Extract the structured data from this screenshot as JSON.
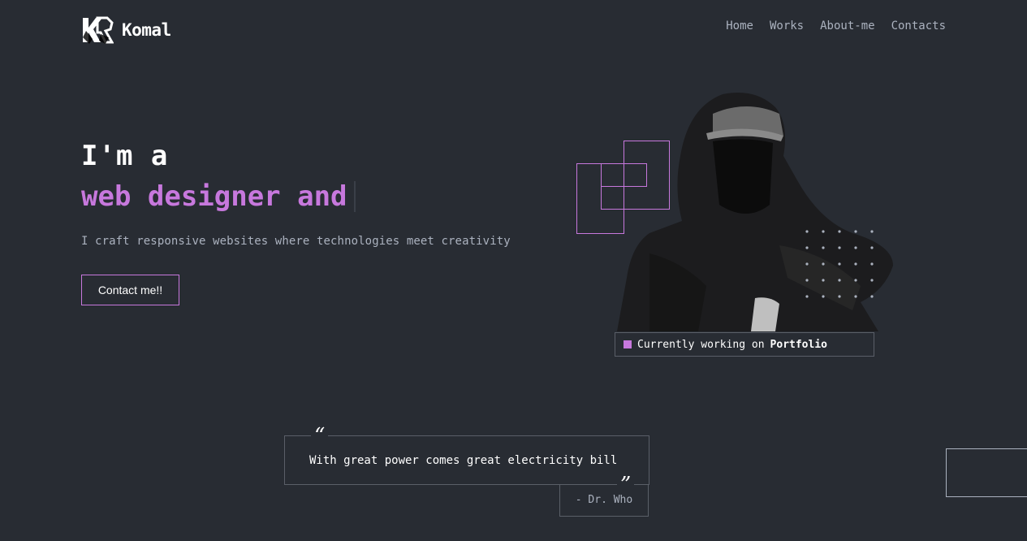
{
  "brand": {
    "name": "Komal",
    "icon": "kr-logo-icon"
  },
  "nav": {
    "items": [
      {
        "label": "Home"
      },
      {
        "label": "Works"
      },
      {
        "label": "About-me"
      },
      {
        "label": "Contacts"
      }
    ]
  },
  "hero": {
    "line1": "I'm a",
    "line2": "web designer and",
    "subtitle": "I craft responsive websites where technologies meet creativity",
    "cta_label": "Contact me!!"
  },
  "status": {
    "text": "Currently working on",
    "project": "Portfolio"
  },
  "quote": {
    "open_mark": "“",
    "text": "With great power comes great electricity bill",
    "close_mark": "”",
    "author": "- Dr. Who"
  },
  "colors": {
    "background": "#282c33",
    "accent": "#c778dd",
    "text": "#abb2bf",
    "heading": "#ffffff"
  }
}
